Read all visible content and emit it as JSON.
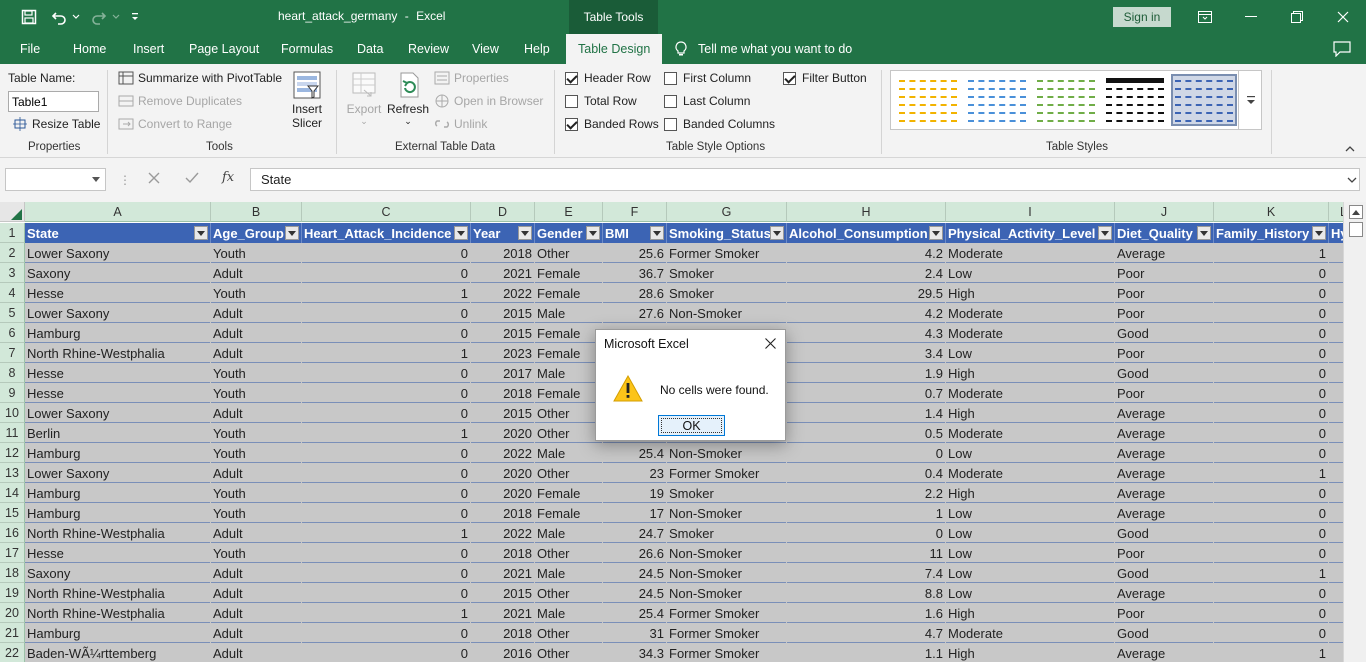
{
  "app": {
    "doc_name": "heart_attack_germany",
    "app_name": "Excel",
    "title_sep": "-",
    "context_tab": "Table Tools",
    "sign_in": "Sign in"
  },
  "tabs": [
    "File",
    "Home",
    "Insert",
    "Page Layout",
    "Formulas",
    "Data",
    "Review",
    "View",
    "Help",
    "Table Design"
  ],
  "active_tab": "Table Design",
  "tell_me": "Tell me what you want to do",
  "ribbon": {
    "properties": {
      "label": "Properties",
      "table_name_label": "Table Name:",
      "table_name_value": "Table1",
      "resize": "Resize Table"
    },
    "tools": {
      "label": "Tools",
      "summarize": "Summarize with PivotTable",
      "remove_dupes": "Remove Duplicates",
      "convert": "Convert to Range",
      "insert_slicer_1": "Insert",
      "insert_slicer_2": "Slicer"
    },
    "external": {
      "label": "External Table Data",
      "export": "Export",
      "refresh": "Refresh",
      "properties": "Properties",
      "open_browser": "Open in Browser",
      "unlink": "Unlink"
    },
    "style_options": {
      "label": "Table Style Options",
      "header_row": "Header Row",
      "total_row": "Total Row",
      "banded_rows": "Banded Rows",
      "first_column": "First Column",
      "last_column": "Last Column",
      "banded_columns": "Banded Columns",
      "filter_button": "Filter Button"
    },
    "styles": {
      "label": "Table Styles",
      "swatch_colors": [
        "#f2b300",
        "#4a90d9",
        "#70ad47",
        "#111111",
        "#3c64b4"
      ]
    }
  },
  "formula": {
    "name_box": "",
    "fx": "fx",
    "content": "State"
  },
  "columns": [
    "A",
    "B",
    "C",
    "D",
    "E",
    "F",
    "G",
    "H",
    "I",
    "J",
    "K",
    "L"
  ],
  "headers": [
    "State",
    "Age_Group",
    "Heart_Attack_Incidence",
    "Year",
    "Gender",
    "BMI",
    "Smoking_Status",
    "Alcohol_Consumption",
    "Physical_Activity_Level",
    "Diet_Quality",
    "Family_History",
    "Hy"
  ],
  "rows": [
    {
      "n": "2",
      "c": [
        "Lower Saxony",
        "Youth",
        "0",
        "2018",
        "Other",
        "25.6",
        "Former Smoker",
        "4.2",
        "Moderate",
        "Average",
        "1"
      ]
    },
    {
      "n": "3",
      "c": [
        "Saxony",
        "Adult",
        "0",
        "2021",
        "Female",
        "36.7",
        "Smoker",
        "2.4",
        "Low",
        "Poor",
        "0"
      ]
    },
    {
      "n": "4",
      "c": [
        "Hesse",
        "Youth",
        "1",
        "2022",
        "Female",
        "28.6",
        "Smoker",
        "29.5",
        "High",
        "Poor",
        "0"
      ]
    },
    {
      "n": "5",
      "c": [
        "Lower Saxony",
        "Adult",
        "0",
        "2015",
        "Male",
        "27.6",
        "Non-Smoker",
        "4.2",
        "Moderate",
        "Poor",
        "0"
      ]
    },
    {
      "n": "6",
      "c": [
        "Hamburg",
        "Adult",
        "0",
        "2015",
        "Female",
        "",
        "",
        "4.3",
        "Moderate",
        "Good",
        "0"
      ]
    },
    {
      "n": "7",
      "c": [
        "North Rhine-Westphalia",
        "Adult",
        "1",
        "2023",
        "Female",
        "",
        "",
        "3.4",
        "Low",
        "Poor",
        "0"
      ]
    },
    {
      "n": "8",
      "c": [
        "Hesse",
        "Youth",
        "0",
        "2017",
        "Male",
        "",
        "",
        "1.9",
        "High",
        "Good",
        "0"
      ]
    },
    {
      "n": "9",
      "c": [
        "Hesse",
        "Youth",
        "0",
        "2018",
        "Female",
        "",
        "",
        "0.7",
        "Moderate",
        "Poor",
        "0"
      ]
    },
    {
      "n": "10",
      "c": [
        "Lower Saxony",
        "Adult",
        "0",
        "2015",
        "Other",
        "",
        "",
        "1.4",
        "High",
        "Average",
        "0"
      ]
    },
    {
      "n": "11",
      "c": [
        "Berlin",
        "Youth",
        "1",
        "2020",
        "Other",
        "",
        "",
        "0.5",
        "Moderate",
        "Average",
        "0"
      ]
    },
    {
      "n": "12",
      "c": [
        "Hamburg",
        "Youth",
        "0",
        "2022",
        "Male",
        "25.4",
        "Non-Smoker",
        "0",
        "Low",
        "Average",
        "0"
      ]
    },
    {
      "n": "13",
      "c": [
        "Lower Saxony",
        "Adult",
        "0",
        "2020",
        "Other",
        "23",
        "Former Smoker",
        "0.4",
        "Moderate",
        "Average",
        "1"
      ]
    },
    {
      "n": "14",
      "c": [
        "Hamburg",
        "Youth",
        "0",
        "2020",
        "Female",
        "19",
        "Smoker",
        "2.2",
        "High",
        "Average",
        "0"
      ]
    },
    {
      "n": "15",
      "c": [
        "Hamburg",
        "Youth",
        "0",
        "2018",
        "Female",
        "17",
        "Non-Smoker",
        "1",
        "Low",
        "Average",
        "0"
      ]
    },
    {
      "n": "16",
      "c": [
        "North Rhine-Westphalia",
        "Adult",
        "1",
        "2022",
        "Male",
        "24.7",
        "Smoker",
        "0",
        "Low",
        "Good",
        "0"
      ]
    },
    {
      "n": "17",
      "c": [
        "Hesse",
        "Youth",
        "0",
        "2018",
        "Other",
        "26.6",
        "Non-Smoker",
        "11",
        "Low",
        "Poor",
        "0"
      ]
    },
    {
      "n": "18",
      "c": [
        "Saxony",
        "Adult",
        "0",
        "2021",
        "Male",
        "24.5",
        "Non-Smoker",
        "7.4",
        "Low",
        "Good",
        "1"
      ]
    },
    {
      "n": "19",
      "c": [
        "North Rhine-Westphalia",
        "Adult",
        "0",
        "2015",
        "Other",
        "24.5",
        "Non-Smoker",
        "8.8",
        "Low",
        "Average",
        "0"
      ]
    },
    {
      "n": "20",
      "c": [
        "North Rhine-Westphalia",
        "Adult",
        "1",
        "2021",
        "Male",
        "25.4",
        "Former Smoker",
        "1.6",
        "High",
        "Poor",
        "0"
      ]
    },
    {
      "n": "21",
      "c": [
        "Hamburg",
        "Adult",
        "0",
        "2018",
        "Other",
        "31",
        "Former Smoker",
        "4.7",
        "Moderate",
        "Good",
        "0"
      ]
    },
    {
      "n": "22",
      "c": [
        "Baden-WÃ¼rttemberg",
        "Adult",
        "0",
        "2016",
        "Other",
        "34.3",
        "Former Smoker",
        "1.1",
        "High",
        "Average",
        "1"
      ]
    }
  ],
  "header_row_num": "1",
  "dialog": {
    "title": "Microsoft Excel",
    "message": "No cells were found.",
    "ok": "OK"
  }
}
